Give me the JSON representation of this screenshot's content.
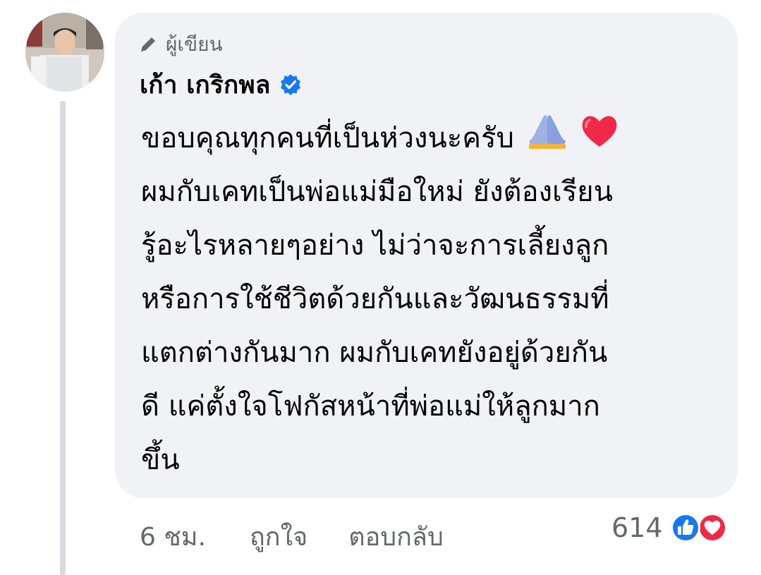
{
  "comment": {
    "author_badge_label": "ผู้เขียน",
    "author_name": "เก้า เกริกพล",
    "verified": true,
    "text_lines": [
      "ขอบคุณทุกคนที่เป็นห่วงนะครับ",
      "ผมกับเคทเป็นพ่อแม่มือใหม่ ยังต้องเรียน",
      "รู้อะไรหลายๆอย่าง ไม่ว่าจะการเลี้ยงลูก",
      "หรือการใช้ชีวิตด้วยกันและวัฒนธรรมที่",
      "แตกต่างกันมาก ผมกับเคทยังอยู่ด้วยกัน",
      "ดี แค่ตั้งใจโฟกัสหน้าที่พ่อแม่ให้ลูกมาก",
      "ขึ้น"
    ],
    "inline_emojis": [
      "folded-hands-icon",
      "red-heart-icon"
    ],
    "time": "6 ชม.",
    "like_label": "ถูกใจ",
    "reply_label": "ตอบกลับ",
    "reaction_count": "614",
    "reaction_icons": [
      "like-reaction-icon",
      "love-reaction-icon"
    ]
  },
  "colors": {
    "bubble_bg": "#f0f2f5",
    "text": "#050505",
    "secondary_text": "#65676b",
    "verified_blue": "#1877f2",
    "like_blue": "#1877f2",
    "love_red": "#f02849",
    "thread_line": "#d8dadf"
  }
}
